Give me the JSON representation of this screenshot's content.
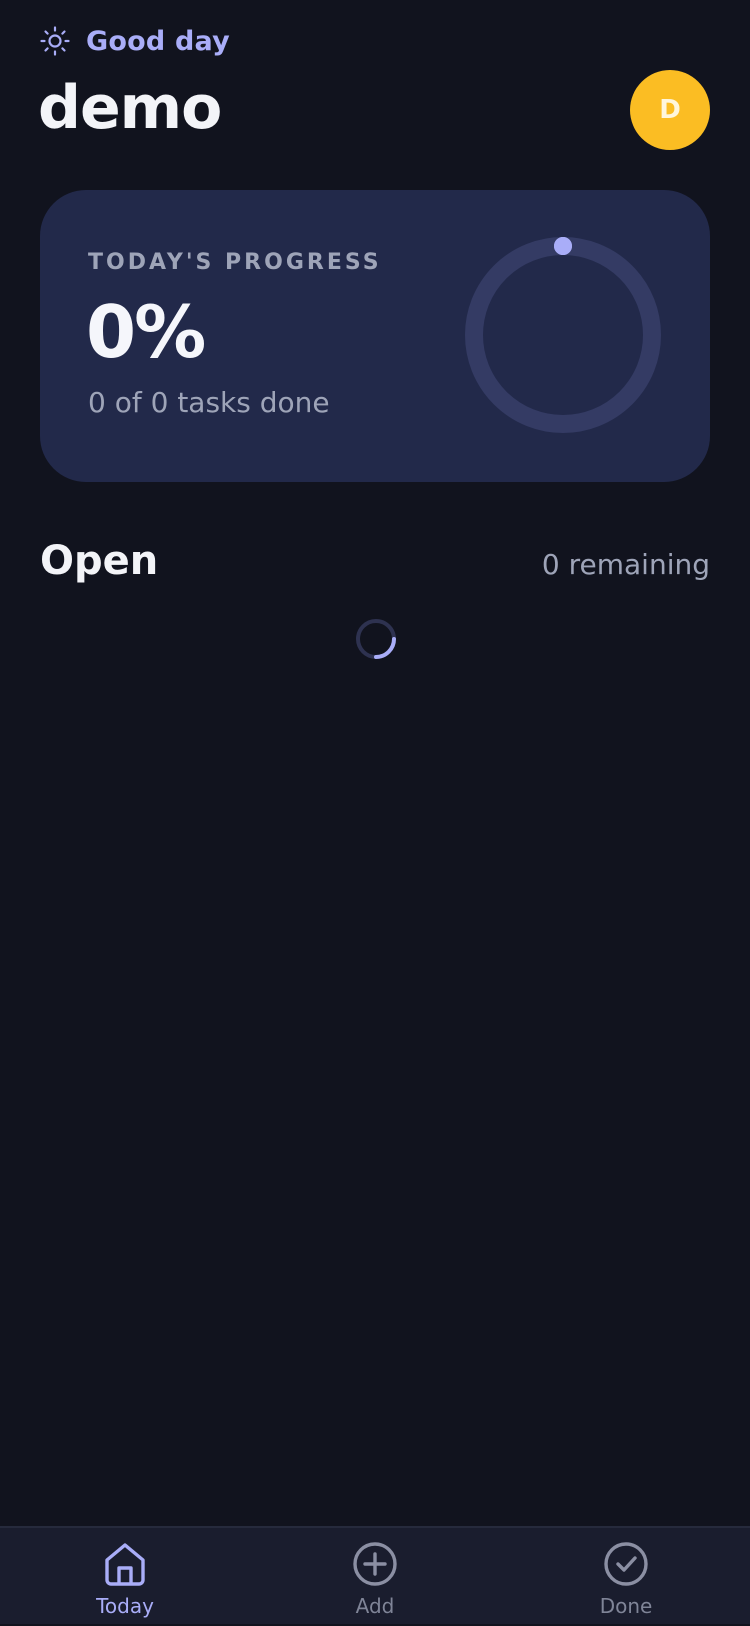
{
  "header": {
    "greeting": "Good day",
    "greeting_icon": "sun-icon",
    "username": "demo",
    "avatar_initial": "D"
  },
  "progress": {
    "label": "TODAY'S PROGRESS",
    "percent_text": "0%",
    "percent_value": 0,
    "summary": "0 of 0 tasks done"
  },
  "open_section": {
    "title": "Open",
    "remaining": "0 remaining",
    "loading": true
  },
  "tabs": [
    {
      "label": "Today",
      "icon": "home-icon",
      "active": true
    },
    {
      "label": "Add",
      "icon": "plus-circle-icon",
      "active": false
    },
    {
      "label": "Done",
      "icon": "check-circle-icon",
      "active": false
    }
  ],
  "colors": {
    "background": "#11131e",
    "card": "#22294a",
    "accent": "#a9adf8",
    "avatar": "#fbbd23",
    "muted_text": "#9ea4b8",
    "tabbar": "#1a1d2e"
  }
}
